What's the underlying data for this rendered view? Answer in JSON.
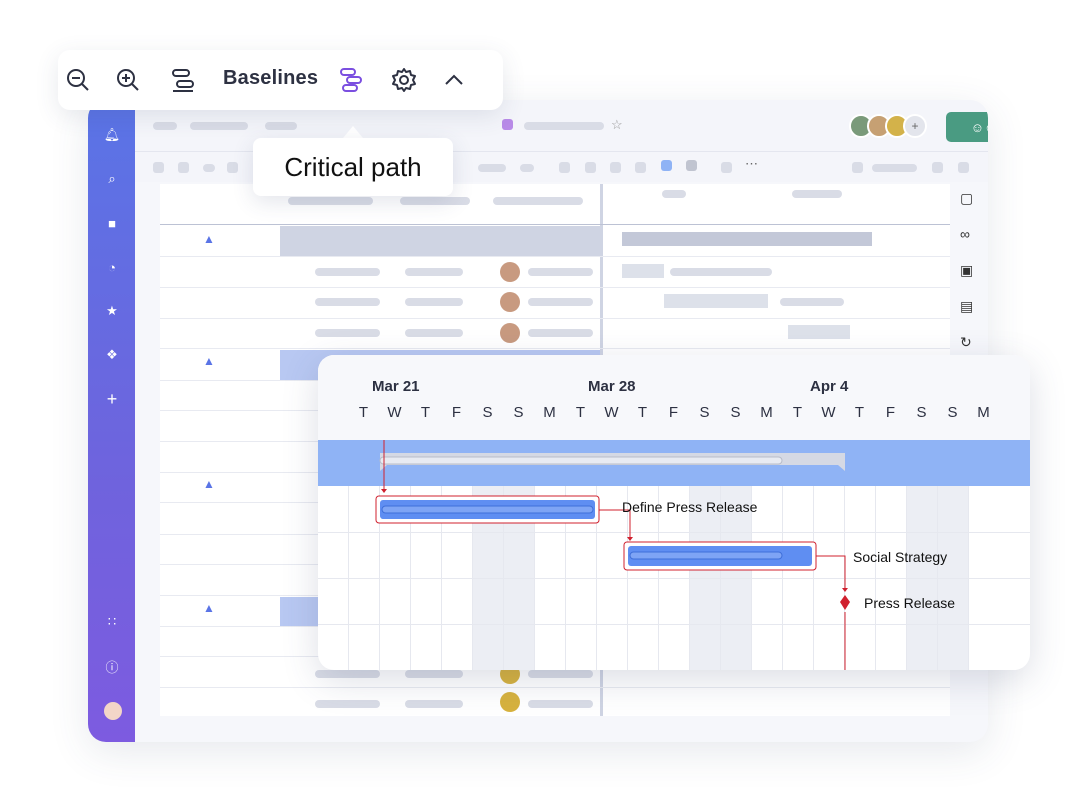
{
  "toolbar": {
    "baselines_label": "Baselines",
    "icons": [
      "zoom-out-icon",
      "zoom-in-icon",
      "baselines-icon",
      "critical-path-icon",
      "gear-icon",
      "chevron-up-icon"
    ]
  },
  "tooltip": {
    "text": "Critical path"
  },
  "gantt": {
    "weeks": [
      "Mar 21",
      "Mar 28",
      "Apr 4"
    ],
    "days": [
      "T",
      "W",
      "T",
      "F",
      "S",
      "S",
      "M",
      "T",
      "W",
      "T",
      "F",
      "S",
      "S",
      "M",
      "T",
      "W",
      "T",
      "F",
      "S",
      "S",
      "M"
    ],
    "tasks": [
      {
        "name": "Define Press Release"
      },
      {
        "name": "Social Strategy"
      },
      {
        "name": "Press Release"
      }
    ]
  },
  "colors": {
    "sidebar": "#5a74e6",
    "critical": "#d0202e",
    "bar": "#5f8ef2",
    "band": "#8fb3f5",
    "share": "#4a9b82",
    "accent": "#7b4fe0"
  }
}
